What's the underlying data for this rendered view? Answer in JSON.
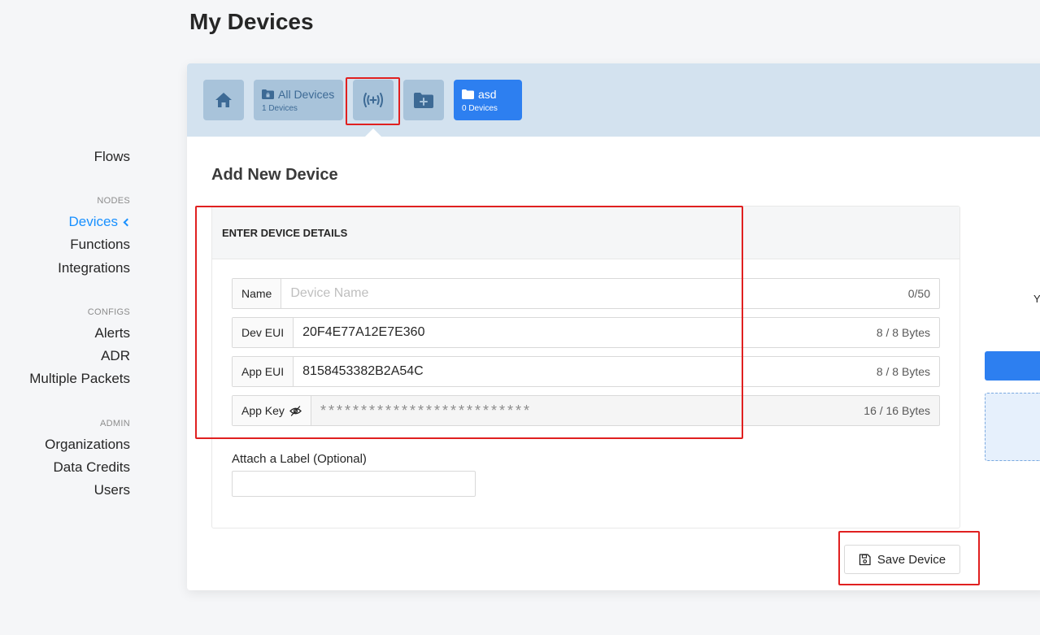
{
  "page": {
    "title": "My Devices"
  },
  "sidebar": {
    "top_items": [
      {
        "label": "Flows"
      }
    ],
    "sections": [
      {
        "heading": "NODES",
        "items": [
          {
            "label": "Devices",
            "active": true
          },
          {
            "label": "Functions"
          },
          {
            "label": "Integrations"
          }
        ]
      },
      {
        "heading": "CONFIGS",
        "items": [
          {
            "label": "Alerts"
          },
          {
            "label": "ADR"
          },
          {
            "label": "Multiple Packets"
          }
        ]
      },
      {
        "heading": "ADMIN",
        "items": [
          {
            "label": "Organizations"
          },
          {
            "label": "Data Credits"
          },
          {
            "label": "Users"
          }
        ]
      }
    ]
  },
  "topbar": {
    "home_icon": "home-icon",
    "all_devices": {
      "label": "All Devices",
      "count": "1 Devices",
      "icon": "lock-folder-icon"
    },
    "add_device_icon": "antenna-plus-icon",
    "add_folder_icon": "folder-plus-icon",
    "folder": {
      "label": "asd",
      "count": "0 Devices",
      "icon": "folder-icon"
    }
  },
  "form": {
    "title": "Add New Device",
    "section_header": "ENTER DEVICE DETAILS",
    "name": {
      "label": "Name",
      "placeholder": "Device Name",
      "value": "",
      "counter": "0/50"
    },
    "dev_eui": {
      "label": "Dev EUI",
      "value": "20F4E77A12E7E360",
      "counter": "8 / 8 Bytes"
    },
    "app_eui": {
      "label": "App EUI",
      "value": "8158453382B2A54C",
      "counter": "8 / 8 Bytes"
    },
    "app_key": {
      "label": "App Key",
      "value": "**************************",
      "counter": "16 / 16 Bytes",
      "icon": "eye-slash-icon"
    },
    "attach_label": {
      "title": "Attach a Label (Optional)",
      "value": ""
    },
    "save_button": "Save Device"
  },
  "right_panel": {
    "fragment_text": "Y"
  },
  "colors": {
    "accent": "#1890ff",
    "primary_button": "#2d7ff0",
    "topbar_bg": "#d3e2ef",
    "highlight": "#e02020"
  }
}
